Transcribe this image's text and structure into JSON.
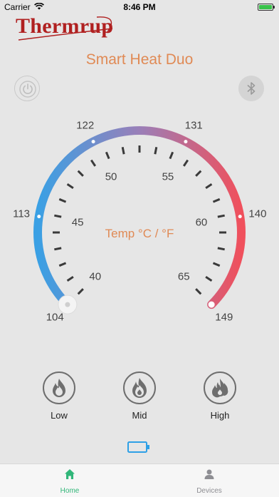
{
  "status_bar": {
    "carrier": "Carrier",
    "time": "8:46 PM"
  },
  "brand": {
    "logo_text": "Thermrup",
    "subtitle": "Smart Heat Duo"
  },
  "gauge": {
    "center_label": "Temp °C / °F",
    "fahrenheit_labels": [
      "104",
      "113",
      "122",
      "131",
      "140",
      "149"
    ],
    "celsius_labels": [
      "40",
      "45",
      "50",
      "55",
      "60",
      "65"
    ],
    "current_value_f": 104,
    "min_f": 104,
    "max_f": 149,
    "colors": {
      "cold": "#3aa0e4",
      "mid": "#9a7fb8",
      "hot": "#f0505c"
    }
  },
  "heat_modes": [
    {
      "label": "Low"
    },
    {
      "label": "Mid"
    },
    {
      "label": "High"
    }
  ],
  "tabs": [
    {
      "label": "Home",
      "active": true
    },
    {
      "label": "Devices",
      "active": false
    }
  ],
  "accent_color": "#31b679"
}
